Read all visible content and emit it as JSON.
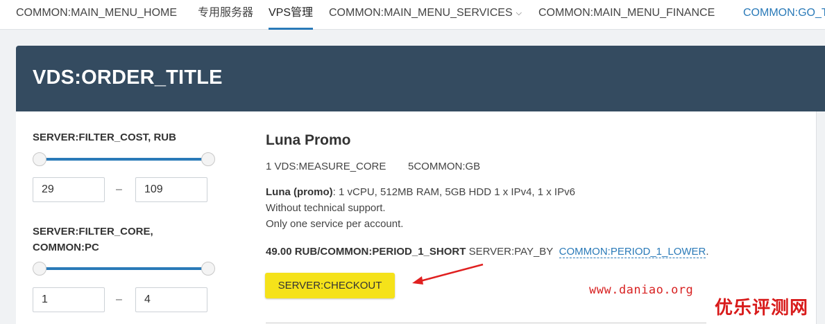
{
  "nav": {
    "items": [
      {
        "label": "COMMON:MAIN_MENU_HOME",
        "active": false
      },
      {
        "label": "专用服务器",
        "active": false
      },
      {
        "label": "VPS管理",
        "active": true
      },
      {
        "label": "COMMON:MAIN_MENU_SERVICES",
        "active": false,
        "dropdown": true
      },
      {
        "label": "COMMON:MAIN_MENU_FINANCE",
        "active": false
      },
      {
        "label": "COMMON:GO_T",
        "active": false,
        "link": true
      }
    ],
    "services_chevron": "chevron-down-icon"
  },
  "header": {
    "title": "VDS:ORDER_TITLE"
  },
  "filters": {
    "cost": {
      "label": "SERVER:FILTER_COST, RUB",
      "min": "29",
      "max": "109",
      "separator": "–",
      "range_fill": 1.0
    },
    "core": {
      "label_line1": "SERVER:FILTER_CORE,",
      "label_line2": "COMMON:PC",
      "min": "1",
      "max": "4",
      "separator": "–",
      "range_fill": 1.0
    }
  },
  "product": {
    "name": "Luna Promo",
    "spec_cores": "1 VDS:MEASURE_CORE",
    "spec_ram": "5COMMON:GB",
    "desc_bold": "Luna (promo)",
    "desc_rest": ": 1 vCPU, 512MB RAM, 5GB HDD 1 x IPv4, 1 x IPv6",
    "desc_line2": "Without technical support.",
    "desc_line3": "Only one service per account.",
    "price_bold": "49.00 RUB/COMMON:PERIOD_1_SHORT",
    "pay_by": "SERVER:PAY_BY",
    "period_link": "COMMON:PERIOD_1_LOWER",
    "period_tail": ".",
    "checkout_label": "SERVER:CHECKOUT"
  },
  "watermark": {
    "url": "www.daniao.org",
    "badge": "优乐评测网",
    "color": "#d82222"
  },
  "colors": {
    "accent": "#2a7ab8",
    "header_bg": "#344b60",
    "checkout_bg": "#f5e21a"
  }
}
